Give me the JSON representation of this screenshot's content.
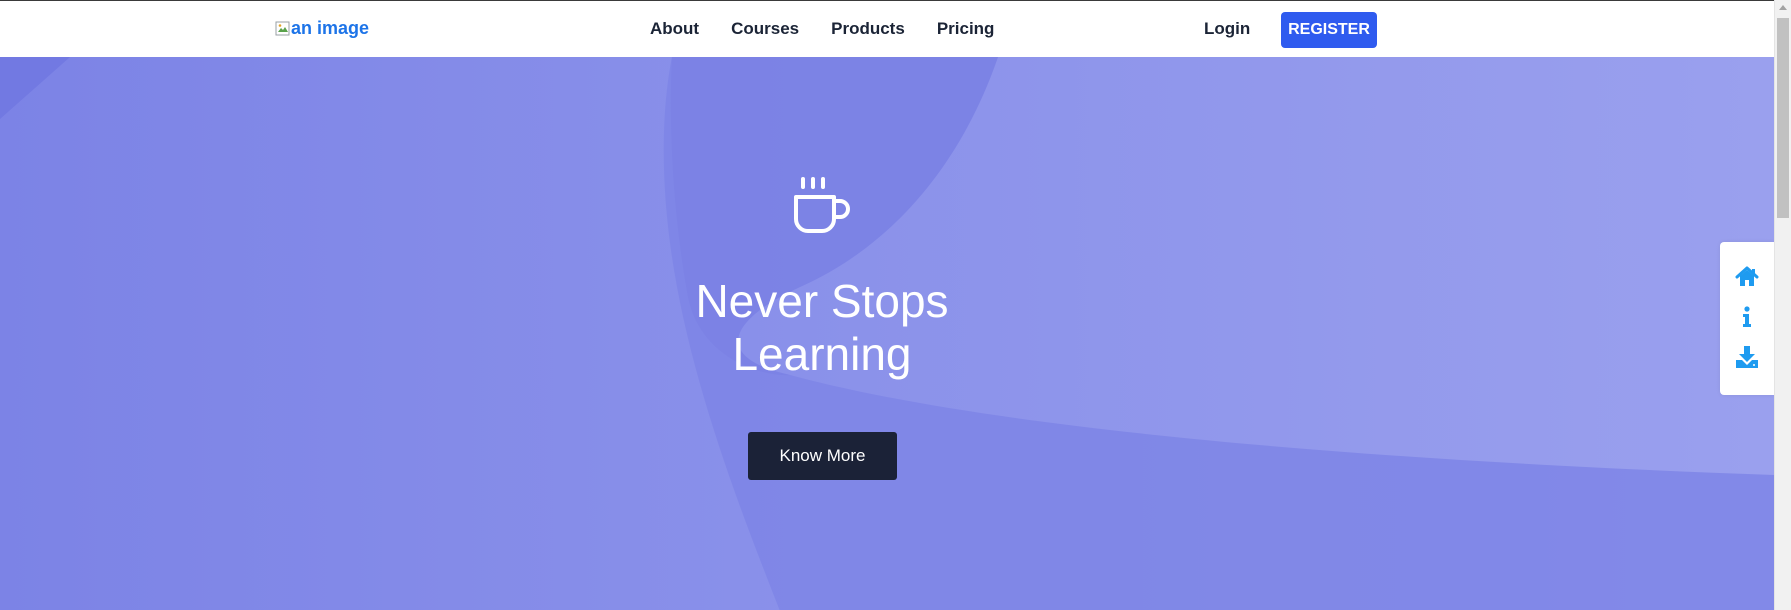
{
  "header": {
    "logo_alt": "an image",
    "nav": [
      {
        "label": "About"
      },
      {
        "label": "Courses"
      },
      {
        "label": "Products"
      },
      {
        "label": "Pricing"
      }
    ],
    "login_label": "Login",
    "register_label": "REGISTER"
  },
  "hero": {
    "icon": "coffee-cup-icon",
    "title_line1": "Never Stops",
    "title_line2": "Learning",
    "cta_label": "Know More"
  },
  "side_menu": {
    "items": [
      {
        "icon": "home-icon"
      },
      {
        "icon": "info-icon"
      },
      {
        "icon": "download-icon"
      }
    ]
  },
  "colors": {
    "brand_blue": "#2f5bef",
    "logo_blue": "#1d74e8",
    "hero_purple": "#8a91ea",
    "dark_navy": "#1b2237",
    "side_icon_blue": "#1e9bf0"
  }
}
